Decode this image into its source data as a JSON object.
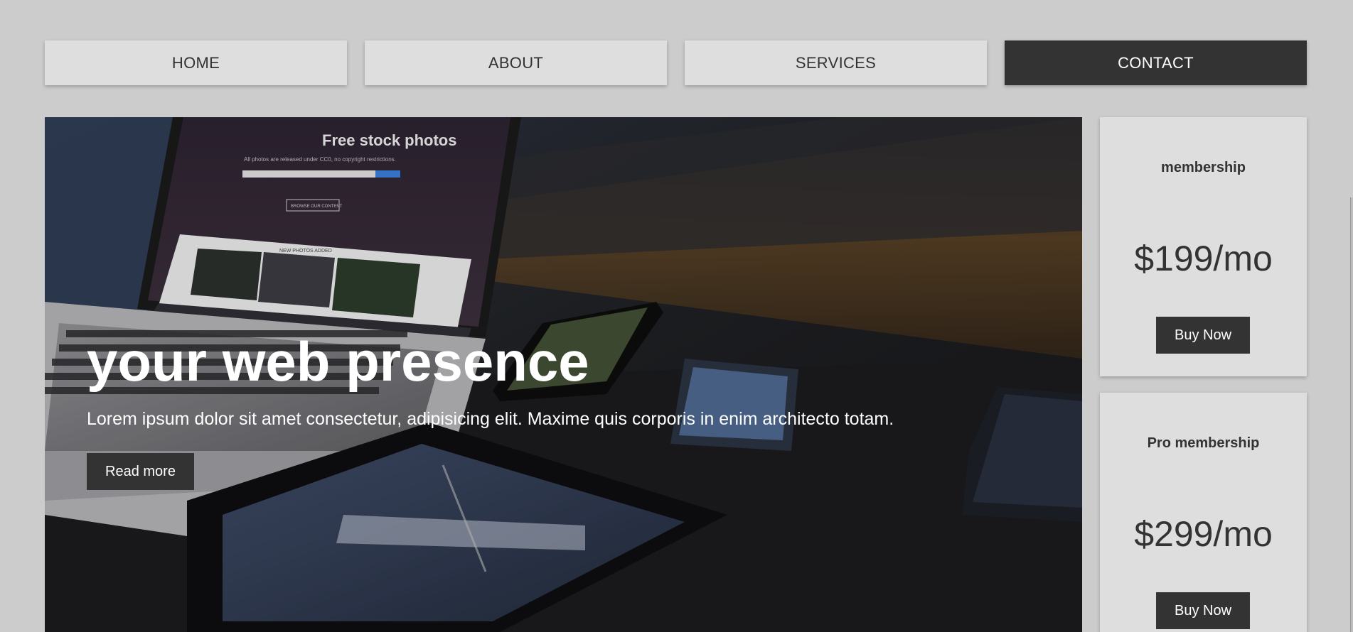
{
  "nav": {
    "items": [
      {
        "label": "HOME"
      },
      {
        "label": "ABOUT"
      },
      {
        "label": "SERVICES"
      },
      {
        "label": "CONTACT"
      }
    ],
    "active": "CONTACT"
  },
  "hero": {
    "title": "your web presence",
    "text": "Lorem ipsum dolor sit amet consectetur, adipisicing elit. Maxime quis corporis in enim architecto totam.",
    "button_label": "Read more",
    "image_semantic": "laptop-and-devices-photo",
    "image_text": {
      "heading": "Free stock photos",
      "sub": "All photos are released under CC0, no copyright restrictions.",
      "browse": "BROWSE OUR CONTENT",
      "new_photos": "NEW PHOTOS ADDED"
    }
  },
  "cards": [
    {
      "title": "membership",
      "price": "$199/mo",
      "button_label": "Buy Now"
    },
    {
      "title": "Pro membership",
      "price": "$299/mo",
      "button_label": "Buy Now"
    }
  ],
  "colors": {
    "background": "#cccccc",
    "panel": "#dedede",
    "dark": "#333333",
    "text_light": "#ffffff"
  }
}
